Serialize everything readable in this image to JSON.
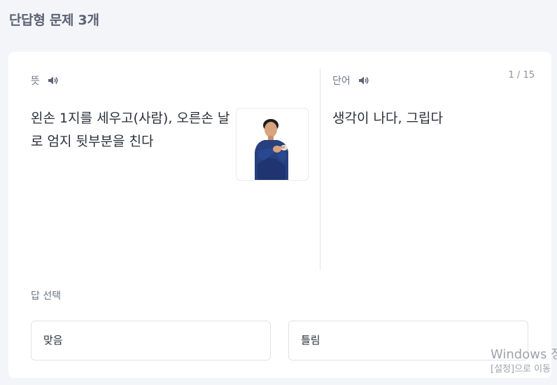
{
  "page": {
    "title": "단답형 문제 3개"
  },
  "question": {
    "meaning_label": "뜻",
    "meaning_text": "왼손 1지를 세우고(사람), 오른손 날로 엄지 뒷부분을 친다",
    "word_label": "단어",
    "word_text": "생각이 나다, 그립다",
    "counter": "1 / 15",
    "icons": {
      "speaker": "speaker-icon",
      "image": "sign-language-image"
    }
  },
  "answer": {
    "label": "답 선택",
    "options": [
      "맞음",
      "틀림"
    ]
  },
  "watermark": {
    "title": "Windows 정",
    "subtitle": "[설정]으로 이동"
  },
  "colors": {
    "background": "#f4f5f8",
    "card": "#ffffff",
    "label": "#6b7585",
    "border": "#dfe2e8"
  }
}
